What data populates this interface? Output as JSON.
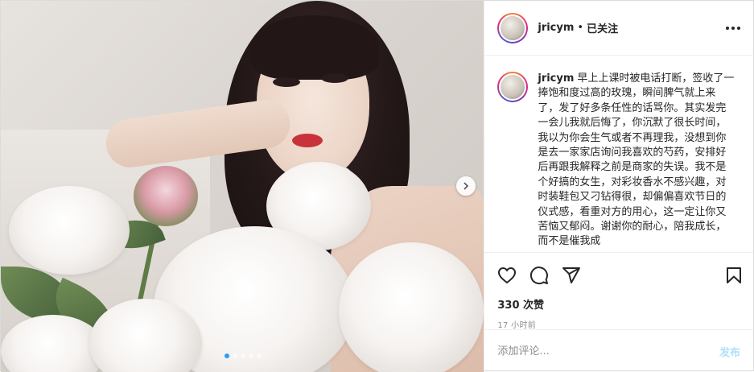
{
  "post": {
    "username": "jricym",
    "separator": "•",
    "follow_status": "已关注",
    "caption_text": "早上上课时被电话打断，签收了一捧饱和度过高的玫瑰，瞬间脾气就上来了，发了好多条任性的话骂你。其实发完一会儿我就后悔了，你沉默了很长时间，我以为你会生气或者不再理我，没想到你是去一家家店询问我喜欢的芍药，安排好后再跟我解释之前是商家的失误。我不是个好搞的女生，对彩妆香水不感兴趣，对时装鞋包又刁钻得很，却偏偏喜欢节日的仪式感，看重对方的用心，这一定让你又苦恼又郁闷。谢谢你的耐心，陪我成长，而不是催我成",
    "likes": "330 次赞",
    "time": "17 小时前"
  },
  "carousel": {
    "count": 5,
    "active_index": 0
  },
  "comment": {
    "placeholder": "添加评论...",
    "post_label": "发布"
  },
  "icons": {
    "like": "heart-icon",
    "comment": "comment-icon",
    "share": "share-icon",
    "save": "bookmark-icon",
    "more": "more-options-icon",
    "next": "chevron-right-icon"
  },
  "colors": {
    "post_button": "#b2dffc",
    "text": "#262626",
    "muted": "#8e8e8e",
    "active_dot": "#2f9cf4"
  }
}
